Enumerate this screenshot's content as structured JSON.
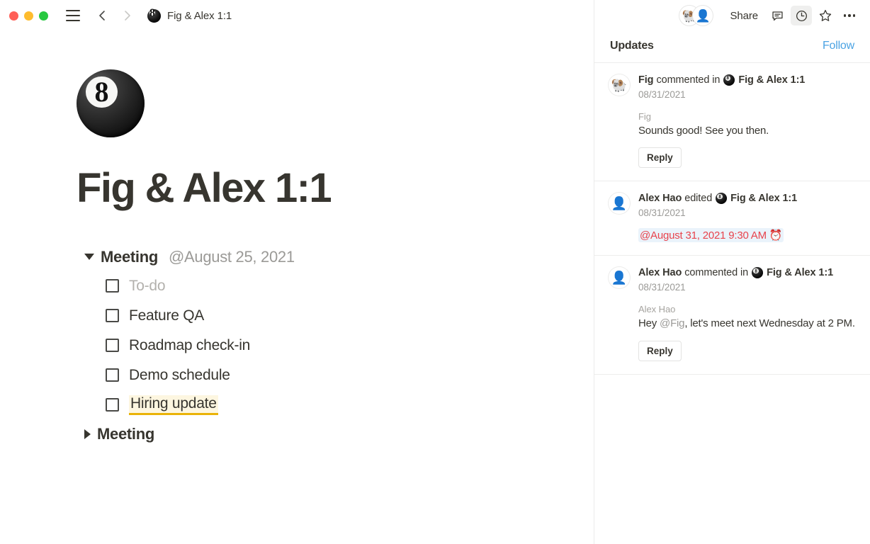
{
  "window": {
    "traffic_lights": [
      {
        "name": "close",
        "color": "#FF5F57"
      },
      {
        "name": "minimize",
        "color": "#FEBC2E"
      },
      {
        "name": "zoom",
        "color": "#28C840"
      }
    ],
    "menu_icon": "hamburger-icon",
    "back_icon": "arrow-left-icon",
    "forward_icon": "arrow-right-icon",
    "breadcrumb_icon": "eight-ball-icon",
    "breadcrumb_title": "Fig & Alex 1:1"
  },
  "page": {
    "icon": "eight-ball-icon",
    "title": "Fig & Alex 1:1",
    "blocks": [
      {
        "type": "toggle",
        "state": "open",
        "label": "Meeting",
        "date": "@August 25, 2021",
        "children": [
          {
            "type": "todo",
            "text": "To-do",
            "checked": false,
            "placeholder": true,
            "highlight": false
          },
          {
            "type": "todo",
            "text": "Feature QA",
            "checked": false,
            "placeholder": false,
            "highlight": false
          },
          {
            "type": "todo",
            "text": "Roadmap check-in",
            "checked": false,
            "placeholder": false,
            "highlight": false
          },
          {
            "type": "todo",
            "text": "Demo schedule",
            "checked": false,
            "placeholder": false,
            "highlight": false
          },
          {
            "type": "todo",
            "text": "Hiring update",
            "checked": false,
            "placeholder": false,
            "highlight": true
          }
        ]
      },
      {
        "type": "toggle",
        "state": "closed",
        "label": "Meeting",
        "date": "",
        "children": []
      }
    ]
  },
  "panel": {
    "avatars": [
      {
        "name": "avatar-fig",
        "glyph": "🐏"
      },
      {
        "name": "avatar-alex",
        "glyph": "👤"
      }
    ],
    "share_label": "Share",
    "comment_icon": "comment-icon",
    "history_icon": "clock-icon",
    "history_active": true,
    "favorite_icon": "star-icon",
    "more_icon": "more-horizontal-icon",
    "title": "Updates",
    "follow_label": "Follow",
    "follow_color": "#4ba3e3",
    "updates": [
      {
        "avatar_glyph": "🐏",
        "avatar_name": "avatar-fig",
        "actor": "Fig",
        "verb": "commented in",
        "page_icon": "eight-ball-icon",
        "page": "Fig & Alex 1:1",
        "date": "08/31/2021",
        "comment": {
          "author": "Fig",
          "text_before": "Sounds good! See you then.",
          "mention": "",
          "text_after": ""
        },
        "reply_label": "Reply",
        "date_mention": ""
      },
      {
        "avatar_glyph": "👤",
        "avatar_name": "avatar-alex",
        "actor": "Alex Hao",
        "verb": "edited",
        "page_icon": "eight-ball-icon",
        "page": "Fig & Alex 1:1",
        "date": "08/31/2021",
        "comment": null,
        "reply_label": "",
        "date_mention": "@August 31, 2021 9:30 AM ⏰"
      },
      {
        "avatar_glyph": "👤",
        "avatar_name": "avatar-alex",
        "actor": "Alex Hao",
        "verb": "commented in",
        "page_icon": "eight-ball-icon",
        "page": "Fig & Alex 1:1",
        "date": "08/31/2021",
        "comment": {
          "author": "Alex Hao",
          "text_before": "Hey ",
          "mention": "@Fig",
          "text_after": ", let's meet next Wednesday at 2 PM."
        },
        "reply_label": "Reply",
        "date_mention": ""
      }
    ]
  }
}
